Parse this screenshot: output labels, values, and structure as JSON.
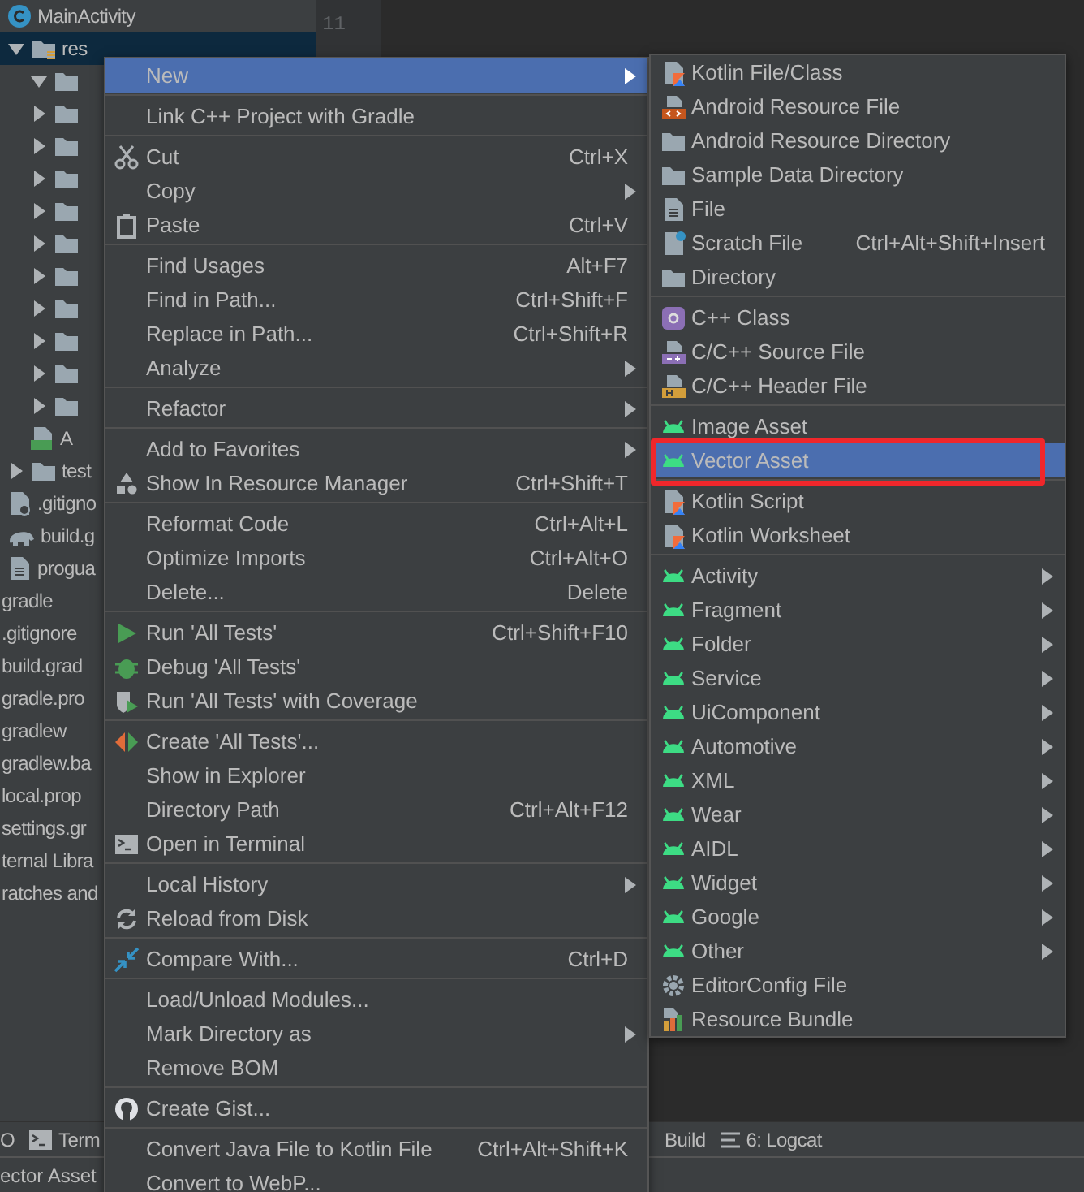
{
  "tree": [
    {
      "label": "MainActivity",
      "kind": "class",
      "selected": false
    },
    {
      "label": "res",
      "kind": "resfolder",
      "selected": true,
      "expanded": true,
      "children": [
        {
          "kind": "folder",
          "selected": false,
          "expanded": true
        },
        {
          "kind": "folder",
          "selected": false,
          "expanded": false
        },
        {
          "kind": "folder",
          "selected": false,
          "expanded": false
        },
        {
          "kind": "folder",
          "selected": false,
          "expanded": false
        },
        {
          "kind": "folder",
          "selected": false,
          "expanded": false
        },
        {
          "kind": "folder",
          "selected": false,
          "expanded": false
        },
        {
          "kind": "folder",
          "selected": false,
          "expanded": false
        },
        {
          "kind": "folder",
          "selected": false,
          "expanded": false
        },
        {
          "kind": "folder",
          "selected": false,
          "expanded": false
        },
        {
          "kind": "folder",
          "selected": false,
          "expanded": false
        },
        {
          "kind": "folder",
          "selected": false,
          "expanded": false
        },
        {
          "label": "A",
          "kind": "manifest",
          "selected": false
        }
      ]
    },
    {
      "label": "test",
      "kind": "folder",
      "selected": false,
      "expanded": false
    },
    {
      "label": ".gitigno",
      "kind": "gitignore",
      "selected": false
    },
    {
      "label": "build.g",
      "kind": "gradle",
      "selected": false
    },
    {
      "label": "progua",
      "kind": "file",
      "selected": false
    },
    {
      "label": "gradle",
      "kind": "plain",
      "selected": false
    },
    {
      "label": ".gitignore",
      "kind": "plain",
      "selected": false
    },
    {
      "label": "build.grad",
      "kind": "plain",
      "selected": false
    },
    {
      "label": "gradle.pro",
      "kind": "plain",
      "selected": false
    },
    {
      "label": "gradlew",
      "kind": "plain",
      "selected": false
    },
    {
      "label": "gradlew.ba",
      "kind": "plain",
      "selected": false
    },
    {
      "label": "local.prop",
      "kind": "plain",
      "selected": false
    },
    {
      "label": "settings.gr",
      "kind": "plain",
      "selected": false
    },
    {
      "label": "ternal Libra",
      "kind": "plain",
      "selected": false
    },
    {
      "label": "ratches and",
      "kind": "plain",
      "selected": false
    }
  ],
  "editor": {
    "line_number": "11"
  },
  "context_menu": {
    "groups": [
      [
        {
          "label": "New",
          "kind": "none",
          "arrow": true,
          "selected": true
        }
      ],
      [
        {
          "label": "Link C++ Project with Gradle",
          "kind": "none",
          "arrow": false,
          "selected": false
        }
      ],
      [
        {
          "label": "Cut",
          "shortcut": "Ctrl+X",
          "kind": "cut",
          "arrow": false,
          "selected": false
        },
        {
          "label": "Copy",
          "kind": "none",
          "arrow": true,
          "selected": false
        },
        {
          "label": "Paste",
          "shortcut": "Ctrl+V",
          "kind": "paste",
          "arrow": false,
          "selected": false
        }
      ],
      [
        {
          "label": "Find Usages",
          "shortcut": "Alt+F7",
          "kind": "none",
          "arrow": false,
          "selected": false
        },
        {
          "label": "Find in Path...",
          "shortcut": "Ctrl+Shift+F",
          "kind": "none",
          "arrow": false,
          "selected": false
        },
        {
          "label": "Replace in Path...",
          "shortcut": "Ctrl+Shift+R",
          "kind": "none",
          "arrow": false,
          "selected": false
        },
        {
          "label": "Analyze",
          "kind": "none",
          "arrow": true,
          "selected": false
        }
      ],
      [
        {
          "label": "Refactor",
          "kind": "none",
          "arrow": true,
          "selected": false
        }
      ],
      [
        {
          "label": "Add to Favorites",
          "kind": "none",
          "arrow": true,
          "selected": false
        },
        {
          "label": "Show In Resource Manager",
          "shortcut": "Ctrl+Shift+T",
          "kind": "resources",
          "arrow": false,
          "selected": false
        }
      ],
      [
        {
          "label": "Reformat Code",
          "shortcut": "Ctrl+Alt+L",
          "kind": "none",
          "arrow": false,
          "selected": false
        },
        {
          "label": "Optimize Imports",
          "shortcut": "Ctrl+Alt+O",
          "kind": "none",
          "arrow": false,
          "selected": false
        },
        {
          "label": "Delete...",
          "shortcut": "Delete",
          "kind": "none",
          "arrow": false,
          "selected": false
        }
      ],
      [
        {
          "label": "Run 'All Tests'",
          "shortcut": "Ctrl+Shift+F10",
          "kind": "run",
          "arrow": false,
          "selected": false
        },
        {
          "label": "Debug 'All Tests'",
          "kind": "debug",
          "arrow": false,
          "selected": false
        },
        {
          "label": "Run 'All Tests' with Coverage",
          "kind": "coverage",
          "arrow": false,
          "selected": false
        }
      ],
      [
        {
          "label": "Create 'All Tests'...",
          "kind": "create",
          "arrow": false,
          "selected": false
        },
        {
          "label": "Show in Explorer",
          "kind": "none",
          "arrow": false,
          "selected": false
        },
        {
          "label": "Directory Path",
          "shortcut": "Ctrl+Alt+F12",
          "kind": "none",
          "arrow": false,
          "selected": false
        },
        {
          "label": "Open in Terminal",
          "kind": "terminal",
          "arrow": false,
          "selected": false
        }
      ],
      [
        {
          "label": "Local History",
          "kind": "none",
          "arrow": true,
          "selected": false
        },
        {
          "label": "Reload from Disk",
          "kind": "reload",
          "arrow": false,
          "selected": false
        }
      ],
      [
        {
          "label": "Compare With...",
          "shortcut": "Ctrl+D",
          "kind": "compare",
          "arrow": false,
          "selected": false
        }
      ],
      [
        {
          "label": "Load/Unload Modules...",
          "kind": "none",
          "arrow": false,
          "selected": false
        },
        {
          "label": "Mark Directory as",
          "kind": "none",
          "arrow": true,
          "selected": false
        },
        {
          "label": "Remove BOM",
          "kind": "none",
          "arrow": false,
          "selected": false
        }
      ],
      [
        {
          "label": "Create Gist...",
          "kind": "logo",
          "arrow": false,
          "selected": false
        }
      ],
      [
        {
          "label": "Convert Java File to Kotlin File",
          "shortcut": "Ctrl+Alt+Shift+K",
          "kind": "none",
          "arrow": false,
          "selected": false
        },
        {
          "label": "Convert to WebP...",
          "kind": "none",
          "arrow": false,
          "selected": false
        }
      ]
    ]
  },
  "new_submenu": {
    "groups": [
      [
        {
          "label": "Kotlin File/Class",
          "kind": "kotlin",
          "arrow": false,
          "selected": false,
          "annotated": false
        },
        {
          "label": "Android Resource File",
          "kind": "resource",
          "arrow": false,
          "selected": false,
          "annotated": false
        },
        {
          "label": "Android Resource Directory",
          "kind": "folder",
          "arrow": false,
          "selected": false,
          "annotated": false
        },
        {
          "label": "Sample Data Directory",
          "kind": "folder",
          "arrow": false,
          "selected": false,
          "annotated": false
        },
        {
          "label": "File",
          "kind": "file",
          "arrow": false,
          "selected": false,
          "annotated": false
        },
        {
          "label": "Scratch File",
          "shortcut": "Ctrl+Alt+Shift+Insert",
          "kind": "scratch",
          "arrow": false,
          "selected": false,
          "annotated": false
        },
        {
          "label": "Directory",
          "kind": "folder",
          "arrow": false,
          "selected": false,
          "annotated": false
        }
      ],
      [
        {
          "label": "C++ Class",
          "kind": "cppclass",
          "arrow": false,
          "selected": false,
          "annotated": false
        },
        {
          "label": "C/C++ Source File",
          "kind": "cppsource",
          "arrow": false,
          "selected": false,
          "annotated": false
        },
        {
          "label": "C/C++ Header File",
          "kind": "cppheader",
          "arrow": false,
          "selected": false,
          "annotated": false
        }
      ],
      [
        {
          "label": "Image Asset",
          "kind": "android",
          "arrow": false,
          "selected": false,
          "annotated": false
        },
        {
          "label": "Vector Asset",
          "kind": "android",
          "arrow": false,
          "selected": true,
          "annotated": true
        }
      ],
      [
        {
          "label": "Kotlin Script",
          "kind": "kotlin",
          "arrow": false,
          "selected": false,
          "annotated": false
        },
        {
          "label": "Kotlin Worksheet",
          "kind": "kotlin",
          "arrow": false,
          "selected": false,
          "annotated": false
        }
      ],
      [
        {
          "label": "Activity",
          "kind": "android",
          "arrow": true,
          "selected": false,
          "annotated": false
        },
        {
          "label": "Fragment",
          "kind": "android",
          "arrow": true,
          "selected": false,
          "annotated": false
        },
        {
          "label": "Folder",
          "kind": "android",
          "arrow": true,
          "selected": false,
          "annotated": false
        },
        {
          "label": "Service",
          "kind": "android",
          "arrow": true,
          "selected": false,
          "annotated": false
        },
        {
          "label": "UiComponent",
          "kind": "android",
          "arrow": true,
          "selected": false,
          "annotated": false
        },
        {
          "label": "Automotive",
          "kind": "android",
          "arrow": true,
          "selected": false,
          "annotated": false
        },
        {
          "label": "XML",
          "kind": "android",
          "arrow": true,
          "selected": false,
          "annotated": false
        },
        {
          "label": "Wear",
          "kind": "android",
          "arrow": true,
          "selected": false,
          "annotated": false
        },
        {
          "label": "AIDL",
          "kind": "android",
          "arrow": true,
          "selected": false,
          "annotated": false
        },
        {
          "label": "Widget",
          "kind": "android",
          "arrow": true,
          "selected": false,
          "annotated": false
        },
        {
          "label": "Google",
          "kind": "android",
          "arrow": true,
          "selected": false,
          "annotated": false
        },
        {
          "label": "Other",
          "kind": "android",
          "arrow": true,
          "selected": false,
          "annotated": false
        },
        {
          "label": "EditorConfig File",
          "kind": "gear",
          "arrow": false,
          "selected": false,
          "annotated": false
        },
        {
          "label": "Resource Bundle",
          "kind": "bundle",
          "arrow": false,
          "selected": false,
          "annotated": false
        }
      ]
    ]
  },
  "tool_window_bar": {
    "left": [
      {
        "label": "O",
        "kind": "none"
      },
      {
        "label": "Term",
        "kind": "terminal"
      }
    ],
    "right": [
      {
        "label": "Build",
        "kind": "none"
      },
      {
        "label": "6: Logcat",
        "kind": "logcat"
      }
    ]
  },
  "status_bar": {
    "message": "ector Asset"
  }
}
